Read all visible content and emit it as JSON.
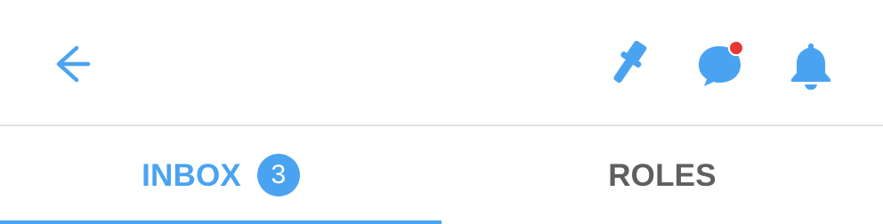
{
  "colors": {
    "accent": "#4aa3f1",
    "tab_inactive": "#5f5f5f",
    "notification_dot": "#e53935",
    "divider": "#e2e2e2",
    "background": "#ffffff"
  },
  "toolbar": {
    "back_icon": "back-arrow-icon",
    "pin_icon": "pin-icon",
    "chat_icon": "chat-bubble-icon",
    "bell_icon": "bell-icon",
    "chat_has_notification": true
  },
  "tabs": [
    {
      "label": "INBOX",
      "badge": "3",
      "active": true
    },
    {
      "label": "ROLES",
      "active": false
    }
  ]
}
